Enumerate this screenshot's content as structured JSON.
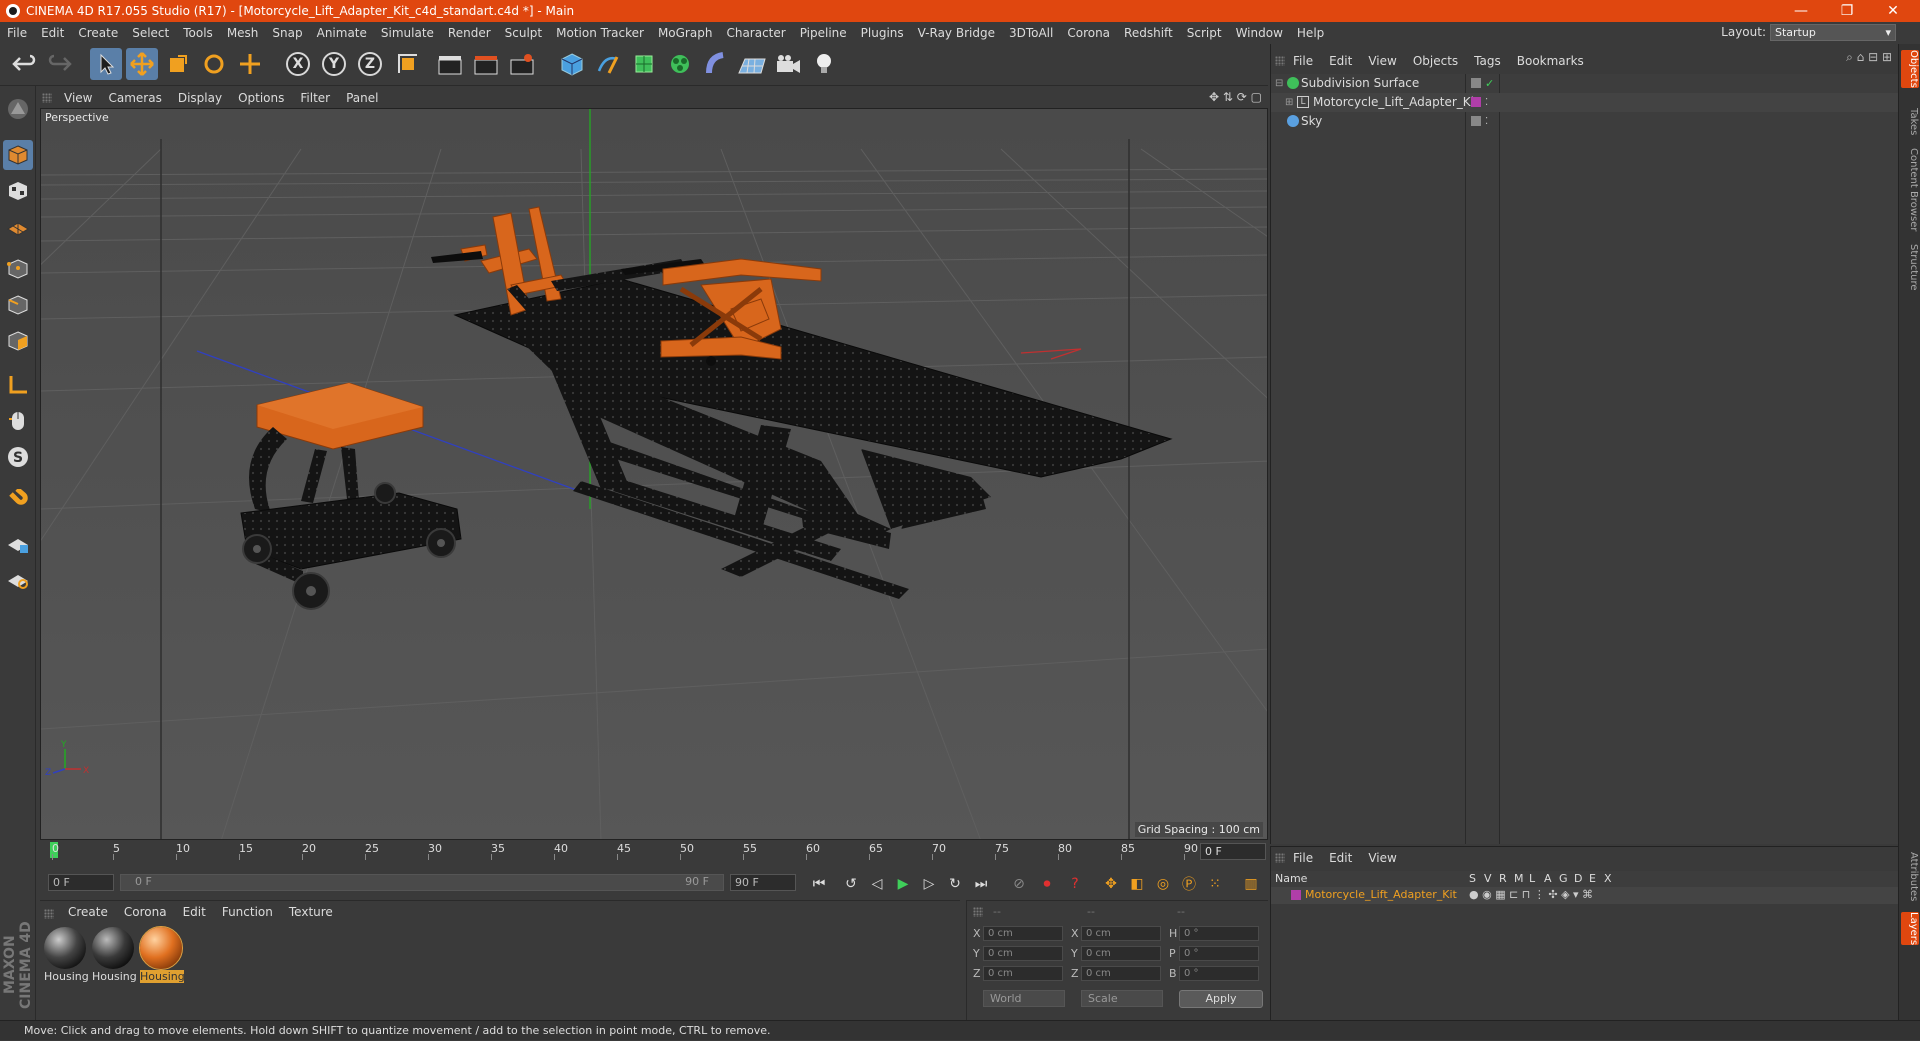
{
  "titlebar": {
    "title": "CINEMA 4D R17.055 Studio (R17) - [Motorcycle_Lift_Adapter_Kit_c4d_standart.c4d *] - Main",
    "minimize": "—",
    "maximize": "❐",
    "close": "✕"
  },
  "menubar": {
    "items": [
      "File",
      "Edit",
      "Create",
      "Select",
      "Tools",
      "Mesh",
      "Snap",
      "Animate",
      "Simulate",
      "Render",
      "Sculpt",
      "Motion Tracker",
      "MoGraph",
      "Character",
      "Pipeline",
      "Plugins",
      "V-Ray Bridge",
      "3DToAll",
      "Corona",
      "Redshift",
      "Script",
      "Window",
      "Help"
    ],
    "layout_label": "Layout:",
    "layout_value": "Startup"
  },
  "toolbar": {
    "axis_x": "X",
    "axis_y": "Y",
    "axis_z": "Z"
  },
  "viewport": {
    "menu": [
      "View",
      "Cameras",
      "Display",
      "Options",
      "Filter",
      "Panel"
    ],
    "camera_label": "Perspective",
    "grid_spacing": "Grid Spacing : 100 cm"
  },
  "timeline": {
    "ticks": [
      "0",
      "5",
      "10",
      "15",
      "20",
      "25",
      "30",
      "35",
      "40",
      "45",
      "50",
      "55",
      "60",
      "65",
      "70",
      "75",
      "80",
      "85",
      "90"
    ],
    "current": "0 F"
  },
  "transport": {
    "start": "0 F",
    "range_start": "0 F",
    "range_end": "90 F",
    "end": "90 F"
  },
  "materials": {
    "menu": [
      "Create",
      "Corona",
      "Edit",
      "Function",
      "Texture"
    ],
    "items": [
      {
        "name": "Housing",
        "color": "#6a6a6a"
      },
      {
        "name": "Housing",
        "color": "#5a5a5a"
      },
      {
        "name": "Housing",
        "color": "#e0701f"
      }
    ]
  },
  "coords": {
    "header": [
      "--",
      "--",
      "--"
    ],
    "rows": [
      {
        "a": "X",
        "va": "0 cm",
        "b": "X",
        "vb": "0 cm",
        "c": "H",
        "vc": "0 °"
      },
      {
        "a": "Y",
        "va": "0 cm",
        "b": "Y",
        "vb": "0 cm",
        "c": "P",
        "vc": "0 °"
      },
      {
        "a": "Z",
        "va": "0 cm",
        "b": "Z",
        "vb": "0 cm",
        "c": "B",
        "vc": "0 °"
      }
    ],
    "world": "World",
    "scale": "Scale",
    "apply": "Apply"
  },
  "objects": {
    "menu": [
      "File",
      "Edit",
      "View",
      "Objects",
      "Tags",
      "Bookmarks"
    ],
    "items": [
      {
        "name": "Subdivision Surface",
        "color": "#3fbf5a"
      },
      {
        "name": "Motorcycle_Lift_Adapter_Kit",
        "color": "#b03ea8"
      },
      {
        "name": "Sky",
        "color": "#5aa0e0"
      }
    ]
  },
  "layers": {
    "menu": [
      "File",
      "Edit",
      "View"
    ],
    "columns": [
      "Name",
      "S",
      "V",
      "R",
      "M",
      "L",
      "A",
      "G",
      "D",
      "E",
      "X"
    ],
    "row_name": "Motorcycle_Lift_Adapter_Kit",
    "row_color": "#b03ea8"
  },
  "right_tabs": [
    "Objects",
    "Takes",
    "Content Browser",
    "Structure",
    "Attributes",
    "Layers"
  ],
  "status": "Move: Click and drag to move elements. Hold down SHIFT to quantize movement / add to the selection in point mode, CTRL to remove.",
  "brand": "MAXON CINEMA 4D",
  "colors": {
    "accent": "#e0470f",
    "selection": "#5a7fa8",
    "orange": "#e07020"
  }
}
